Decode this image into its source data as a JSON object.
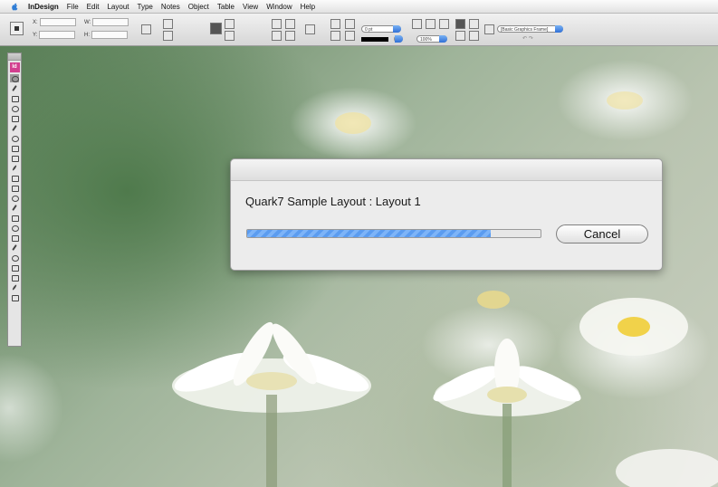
{
  "menubar": {
    "apple_icon": "apple-icon",
    "items": [
      "InDesign",
      "File",
      "Edit",
      "Layout",
      "Type",
      "Notes",
      "Object",
      "Table",
      "View",
      "Window",
      "Help"
    ]
  },
  "control_panel": {
    "x_label": "X:",
    "y_label": "Y:",
    "w_label": "W:",
    "h_label": "H:",
    "stroke_weight": "0 pt",
    "zoom": "100%",
    "object_style": "[Basic Graphics Frame]",
    "fill_color": "#000000"
  },
  "tools": {
    "logo": "Id",
    "items": [
      "selection-tool",
      "direct-selection-tool",
      "position-tool",
      "pen-tool",
      "type-tool",
      "pencil-tool",
      "line-tool",
      "rectangle-frame-tool",
      "rectangle-tool",
      "scissors-tool",
      "free-transform-tool",
      "gradient-tool",
      "note-tool",
      "eyedropper-tool",
      "measure-tool",
      "button-tool",
      "hand-tool",
      "zoom-tool",
      "fill-stroke-tool",
      "swap-tool",
      "default-tool",
      "apply-color-tool",
      "view-mode-tool"
    ]
  },
  "dialog": {
    "message": "Quark7 Sample Layout : Layout 1",
    "progress": 0.83,
    "cancel_label": "Cancel",
    "accent": "#5b9cf0"
  }
}
